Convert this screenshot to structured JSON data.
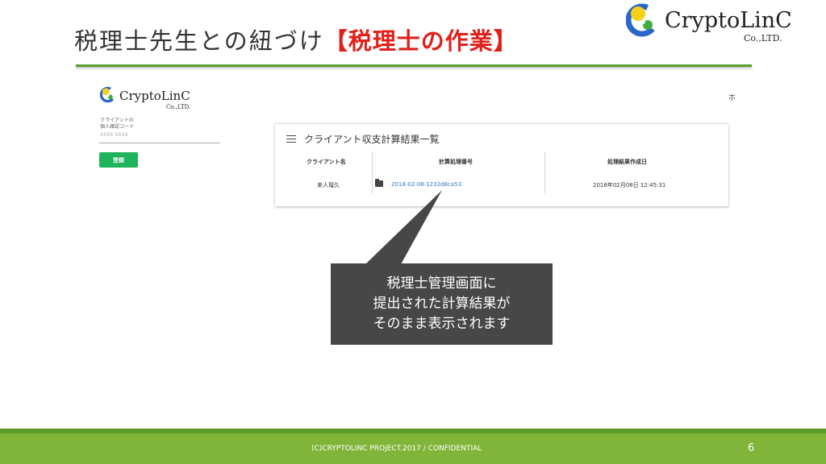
{
  "slide": {
    "title_main": "税理士先生との紐づけ",
    "title_highlight": "【税理士の作業】",
    "page_number": "6",
    "footer": "(C)CRYPTOLINC PROJECT.2017 / CONFIDENTIAL"
  },
  "logo": {
    "name": "CryptoLinC",
    "sub": "Co.,LTD.",
    "icon": "cryptolinc-logo-icon"
  },
  "colors": {
    "accent_green": "#5a9e2e",
    "footer_green": "#80b53a",
    "highlight_red": "#e0201b",
    "button_green": "#1fb35b",
    "link_blue": "#2c77c8",
    "callout_gray": "#474747"
  },
  "app": {
    "nav_truncated": "ホ",
    "field_label_line1": "クライアントの",
    "field_label_line2": "個人確認コード",
    "field_value": "XXXX XXXX",
    "register_button": "登録",
    "card": {
      "title": "クライアント収支計算結果一覧",
      "columns": [
        "クライアント名",
        "計算処理番号",
        "処理結果作成日"
      ],
      "rows": [
        {
          "client": "来人瑠久",
          "calc_id": "2018-02-08-1232d8ca53",
          "created": "2018年02月08日 12:45:31"
        }
      ]
    }
  },
  "callout": {
    "line1": "税理士管理画面に",
    "line2": "提出された計算結果が",
    "line3": "そのまま表示されます"
  }
}
